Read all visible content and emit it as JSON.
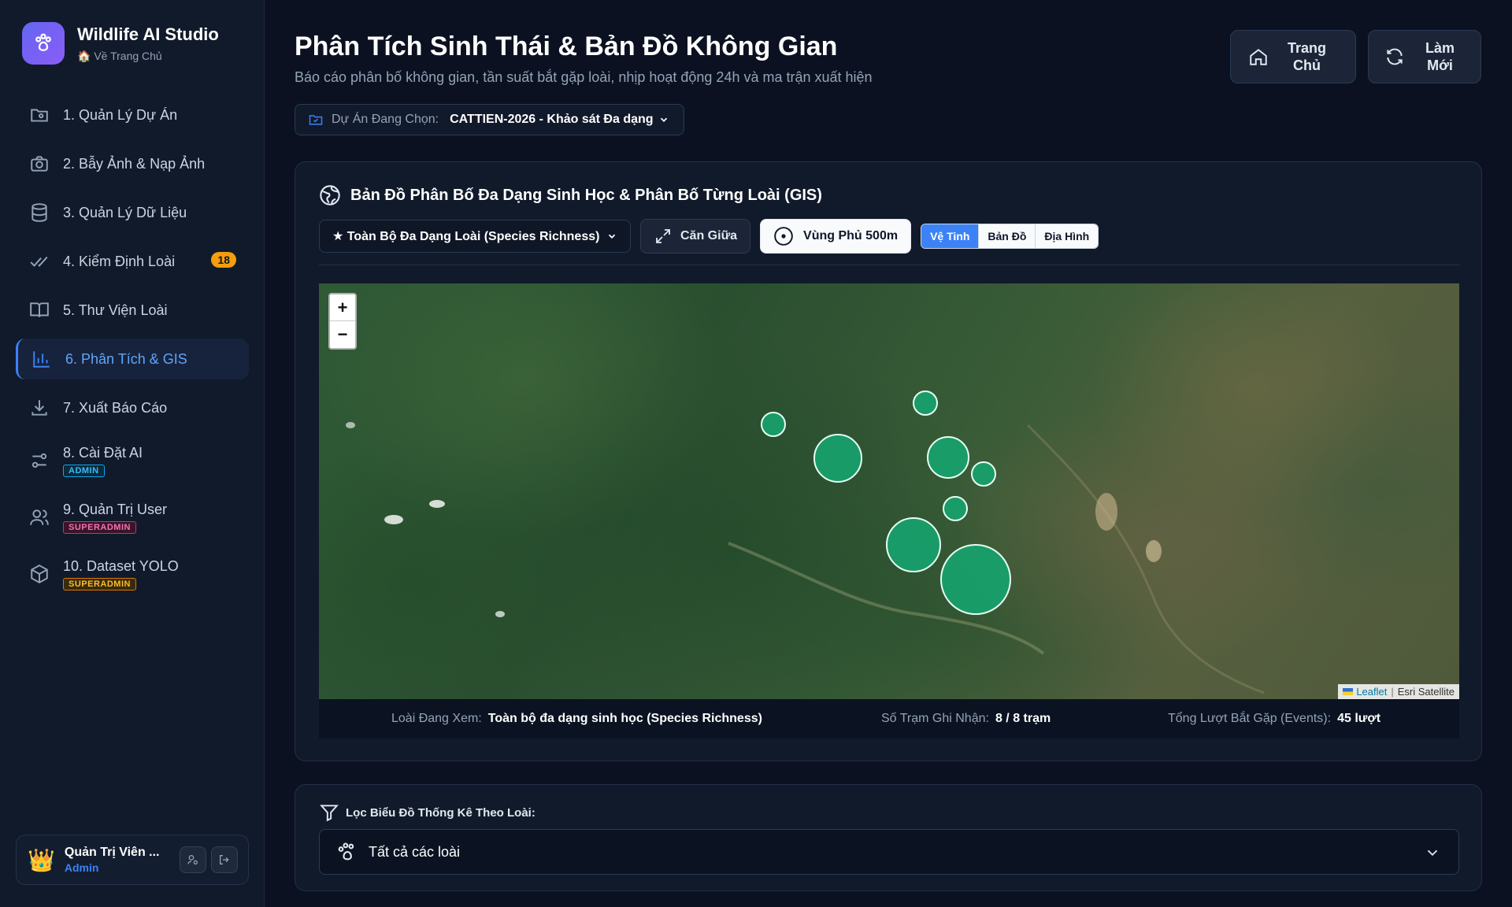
{
  "brand": {
    "title": "Wildlife AI Studio",
    "subtitle": "🏠 Về Trang Chủ"
  },
  "sidebar": {
    "items": [
      {
        "label": "1. Quản Lý Dự Án",
        "icon": "folder-user-icon"
      },
      {
        "label": "2. Bẫy Ảnh & Nạp Ảnh",
        "icon": "camera-icon"
      },
      {
        "label": "3. Quản Lý Dữ Liệu",
        "icon": "database-icon"
      },
      {
        "label": "4. Kiểm Định Loài",
        "icon": "double-check-icon",
        "badge": "18"
      },
      {
        "label": "5. Thư Viện Loài",
        "icon": "book-icon"
      },
      {
        "label": "6. Phân Tích & GIS",
        "icon": "bar-chart-icon",
        "active": true
      },
      {
        "label": "7. Xuất Báo Cáo",
        "icon": "download-icon"
      },
      {
        "label": "8. Cài Đặt AI",
        "icon": "sliders-icon",
        "tag": "ADMIN"
      },
      {
        "label": "9. Quản Trị User",
        "icon": "users-icon",
        "tag": "SUPERADMIN"
      },
      {
        "label": "10. Dataset YOLO",
        "icon": "package-icon",
        "tag": "SUPERADMIN"
      }
    ]
  },
  "user": {
    "name": "Quản Trị Viên ...",
    "role": "Admin",
    "avatar": "👑"
  },
  "header": {
    "title": "Phân Tích Sinh Thái & Bản Đồ Không Gian",
    "subtitle": "Báo cáo phân bố không gian, tần suất bắt gặp loài, nhịp hoạt động 24h và ma trận xuất hiện",
    "home_line1": "Trang",
    "home_line2": "Chủ",
    "refresh_line1": "Làm",
    "refresh_line2": "Mới"
  },
  "project": {
    "label": "Dự Án Đang Chọn:",
    "value": "CATTIEN-2026 - Khảo sát Đa dạng"
  },
  "map_panel": {
    "title": "Bản Đồ Phân Bố Đa Dạng Sinh Học & Phân Bố Từng Loài (GIS)",
    "species_select": "★ Toàn Bộ Đa Dạng Loài (Species Richness)",
    "center_btn": "Căn Giữa",
    "coverage_btn": "Vùng Phủ 500m",
    "layers": [
      "Vệ Tinh",
      "Bản Đồ",
      "Địa Hình"
    ],
    "active_layer": "Vệ Tinh",
    "zoom_in": "+",
    "zoom_out": "−",
    "attribution_leaflet": "Leaflet",
    "attribution_tiles": "Esri Satellite",
    "marker_color": "#16a36e"
  },
  "stats": {
    "species_label": "Loài Đang Xem:",
    "species_value": "Toàn bộ đa dạng sinh học (Species Richness)",
    "stations_label": "Số Trạm Ghi Nhận:",
    "stations_value": "8 / 8 trạm",
    "events_label": "Tổng Lượt Bắt Gặp (Events):",
    "events_value": "45 lượt"
  },
  "filter": {
    "label": "Lọc Biểu Đồ Thống Kê Theo Loài:",
    "value": "Tất cả các loài"
  }
}
